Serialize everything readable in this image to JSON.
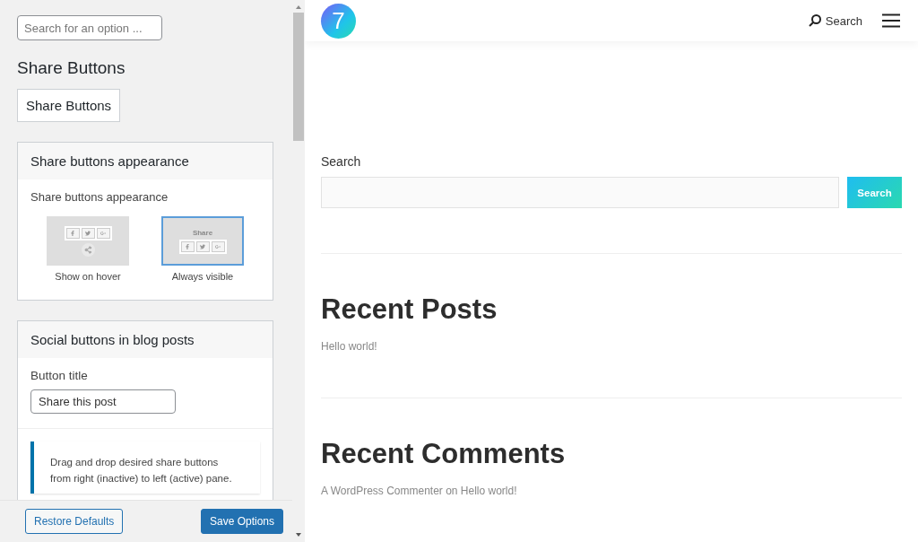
{
  "sidebar": {
    "search": {
      "placeholder": "Search for an option ..."
    },
    "title": "Share Buttons",
    "tabs": [
      {
        "label": "Share Buttons",
        "selected": true
      }
    ],
    "sections": [
      {
        "title": "Share buttons appearance",
        "kind": "appearance",
        "label": "Share buttons appearance",
        "options": [
          {
            "kind": "hover",
            "label": "Show on hover",
            "selected": false
          },
          {
            "kind": "visible",
            "label": "Always visible",
            "preview_title": "Share",
            "selected": true
          }
        ]
      },
      {
        "title": "Social buttons in blog posts",
        "kind": "blog",
        "field_label": "Button title",
        "field_value": "Share this post",
        "notice": "Drag and drop desired share buttons from right (inactive) to left (active) pane."
      }
    ],
    "footer": {
      "restore": "Restore Defaults",
      "save": "Save Options"
    }
  },
  "preview": {
    "logo": "7",
    "header_search": "Search",
    "search_widget": {
      "label": "Search",
      "button": "Search"
    },
    "widgets": [
      {
        "title": "Recent Posts",
        "items": [
          "Hello world!"
        ]
      },
      {
        "title": "Recent Comments",
        "items": [
          "A WordPress Commenter on Hello world!"
        ]
      }
    ]
  }
}
